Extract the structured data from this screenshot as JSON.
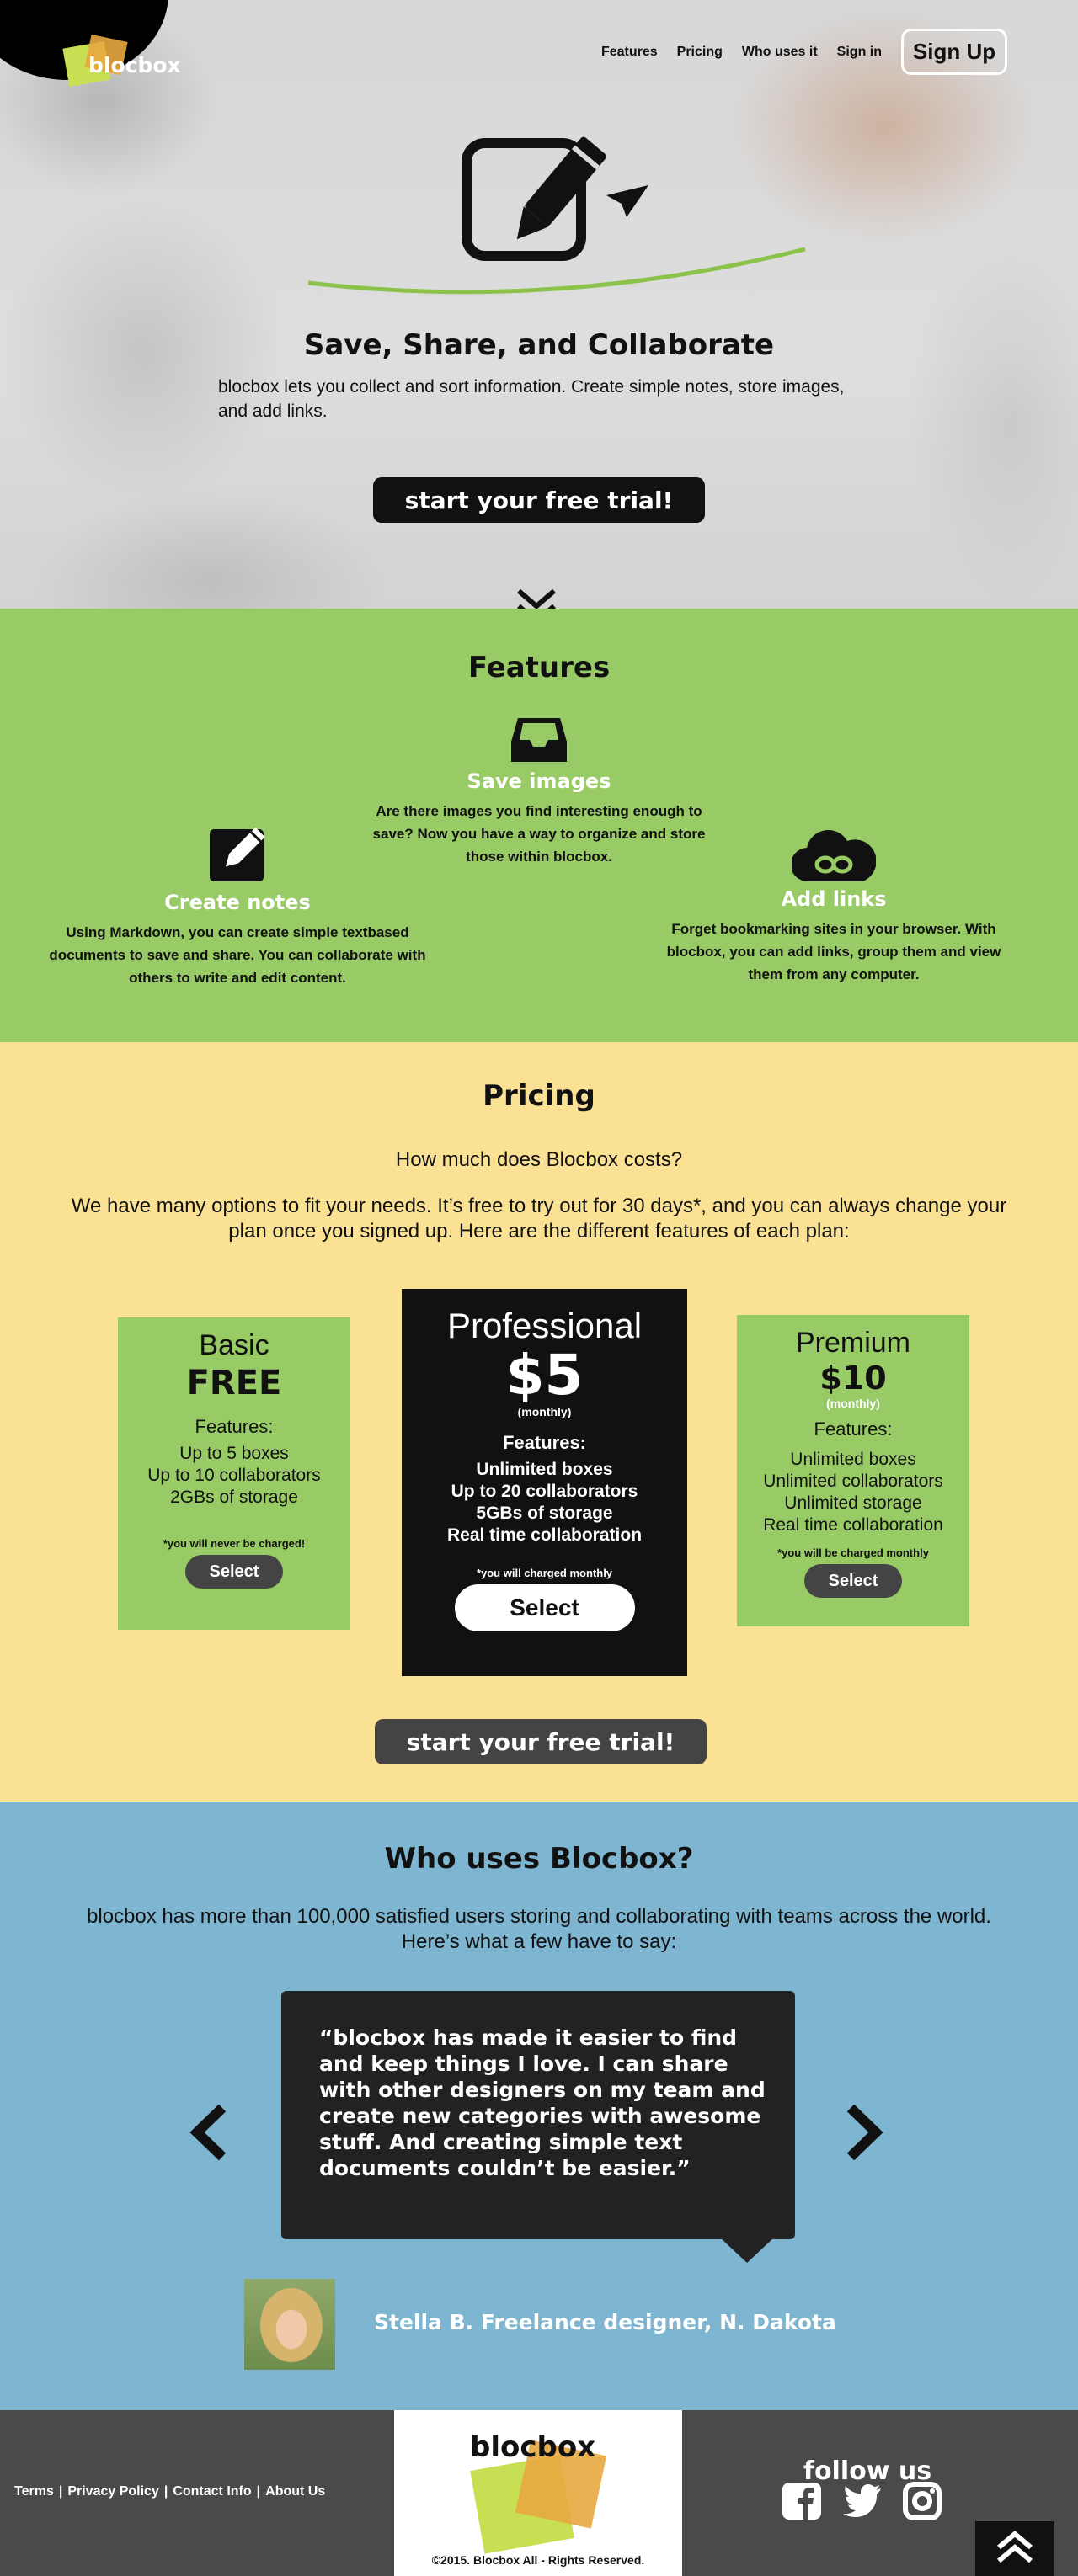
{
  "header": {
    "logo": "blocbox",
    "nav": [
      "Features",
      "Pricing",
      "Who uses it",
      "Sign in"
    ],
    "signup_label": "Sign Up"
  },
  "hero": {
    "title": "Save, Share, and Collaborate",
    "description": "blocbox lets you collect and sort information. Create simple notes, store images, and add links.",
    "cta": "start your free trial!"
  },
  "features": {
    "title": "Features",
    "items": [
      {
        "icon": "inbox-tray-icon",
        "title": "Save images",
        "description": "Are there images you find interesting enough to save? Now you have a way to organize and store those within blocbox."
      },
      {
        "icon": "pencil-note-icon",
        "title": "Create notes",
        "description": "Using Markdown, you can create simple textbased documents to save and share. You can collaborate with others to write and edit content."
      },
      {
        "icon": "cloud-link-icon",
        "title": "Add links",
        "description": "Forget bookmarking sites in your browser. With blocbox, you can add links, group them and view them from any computer."
      }
    ]
  },
  "pricing": {
    "title": "Pricing",
    "question": "How much does Blocbox costs?",
    "description": "We have many options to fit your needs. It’s free to try out for 30 days*, and you can always change your plan once you signed up. Here are the different features of each plan:",
    "plans": [
      {
        "name": "Basic",
        "price": "FREE",
        "sub": "",
        "features_label": "Features:",
        "features": [
          "Up to 5 boxes",
          "Up to 10 collaborators",
          "2GBs of storage"
        ],
        "note": "*you will never be charged!",
        "button": "Select"
      },
      {
        "name": "Professional",
        "price": "$5",
        "sub": "(monthly)",
        "features_label": "Features:",
        "features": [
          "Unlimited boxes",
          "Up to 20 collaborators",
          "5GBs of storage",
          "Real time collaboration"
        ],
        "note": "*you will charged monthly",
        "button": "Select"
      },
      {
        "name": "Premium",
        "price": "$10",
        "sub": "(monthly)",
        "features_label": "Features:",
        "features": [
          "Unlimited boxes",
          "Unlimited collaborators",
          "Unlimited storage",
          "Real time collaboration"
        ],
        "note": "*you will be charged monthly",
        "button": "Select"
      }
    ],
    "cta": "start your free trial!"
  },
  "who": {
    "title": "Who uses Blocbox?",
    "description": "blocbox has more than 100,000 satisfied users storing and collaborating with teams across the world. Here’s what a few have to say:",
    "quote": "“blocbox has made it easier to find and keep things I love. I can share with other designers on my team and create new categories with awesome stuff. And creating simple text documents couldn’t be easier.”",
    "author": "Stella B. Freelance designer, N. Dakota"
  },
  "footer": {
    "links": [
      "Terms",
      "Privacy Policy",
      "Contact Info",
      "About Us"
    ],
    "logo": "blocbox",
    "copyright": "©2015. Blocbox All - Rights Reserved.",
    "follow": "follow us",
    "social": [
      "facebook-icon",
      "twitter-icon",
      "instagram-icon"
    ]
  },
  "colors": {
    "green": "#98cb65",
    "yellow": "#fbe194",
    "blue": "#7eb5d0",
    "dark": "#111111",
    "footer": "#4a4a4a"
  }
}
